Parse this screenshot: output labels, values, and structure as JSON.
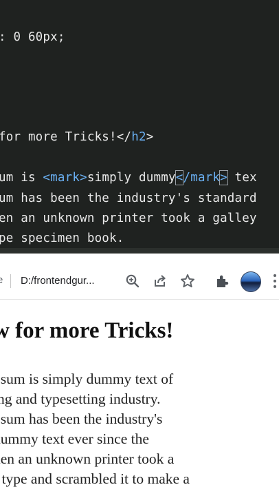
{
  "editor": {
    "lines": [
      {
        "parts": [
          {
            "t": ": 0 60px;",
            "c": "text"
          }
        ]
      },
      {
        "parts": [
          {
            "t": "for more Tricks!",
            "c": "text"
          },
          {
            "t": "</",
            "c": "text"
          },
          {
            "t": "h2",
            "c": "tag"
          },
          {
            "t": ">",
            "c": "text"
          }
        ]
      },
      {
        "parts": [
          {
            "t": "um is ",
            "c": "text"
          },
          {
            "t": "<",
            "c": "tag"
          },
          {
            "t": "mark",
            "c": "tag"
          },
          {
            "t": ">",
            "c": "tag"
          },
          {
            "t": "simply dummy",
            "c": "text"
          },
          {
            "t": "<",
            "c": "tag-box"
          },
          {
            "t": "/",
            "c": "tag"
          },
          {
            "t": "mark",
            "c": "tag"
          },
          {
            "t": ">",
            "c": "tag-box"
          },
          {
            "t": " tex",
            "c": "text"
          }
        ]
      },
      {
        "parts": [
          {
            "t": "um has been the industry's standard",
            "c": "text"
          }
        ]
      },
      {
        "parts": [
          {
            "t": "en an unknown printer took a galley",
            "c": "text"
          }
        ]
      },
      {
        "parts": [
          {
            "t": "pe specimen book.",
            "c": "text"
          }
        ]
      }
    ]
  },
  "browser": {
    "url_prefix": "e",
    "url_text": "D:/frontendgur...",
    "icons": [
      "zoom-icon",
      "share-icon",
      "bookmark-star-icon",
      "extensions-puzzle-icon",
      "profile-avatar-icon",
      "kebab-menu-icon"
    ]
  },
  "page": {
    "heading": "w for more Tricks!",
    "paragraph_lines": [
      "psum is simply dummy text of",
      "ing and typesetting industry.",
      "psum has been the industry's",
      " dummy text ever since the",
      "hen an unknown printer took a",
      "f type and scrambled it to make a"
    ]
  },
  "colors": {
    "editor_bg": "#1f2220",
    "tag": "#6ab0f3",
    "text": "#e8e8e8"
  }
}
